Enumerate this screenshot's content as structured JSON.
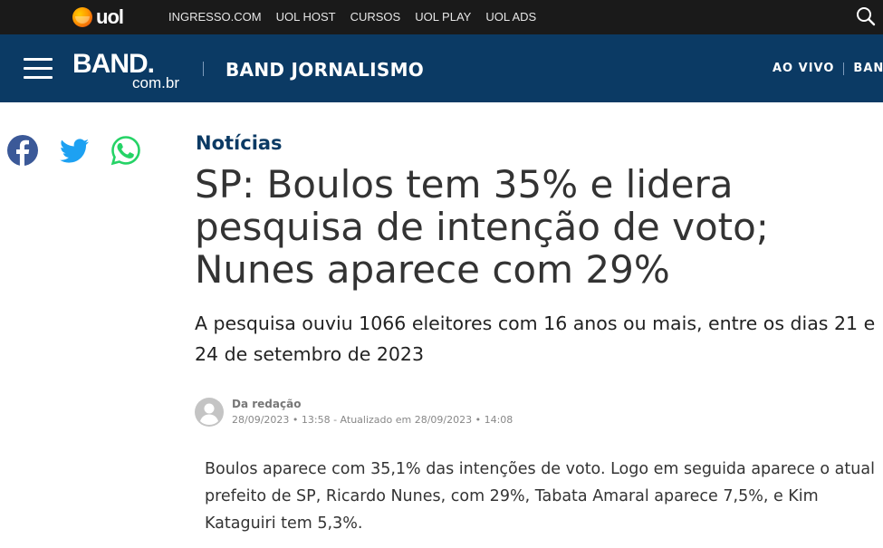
{
  "uol_bar": {
    "logo_text": "uol",
    "links": [
      "INGRESSO.COM",
      "UOL HOST",
      "CURSOS",
      "UOL PLAY",
      "UOL ADS"
    ],
    "search_icon": "search-icon"
  },
  "band_bar": {
    "logo_main": "BAND.",
    "logo_sub": "com.br",
    "section": "BAND JORNALISMO",
    "right_links": [
      "AO VIVO",
      "BAND"
    ],
    "menu_icon": "hamburger-menu-icon",
    "bg_color": "#0b3a64"
  },
  "share": {
    "icons": [
      "facebook-icon",
      "twitter-icon",
      "whatsapp-icon"
    ]
  },
  "article": {
    "kicker": "Notícias",
    "title_lines": [
      "SP: Boulos tem 35% e lidera",
      "pesquisa de intenção de voto;",
      "Nunes aparece com 29%"
    ],
    "subtitle": "A pesquisa ouviu 1066 eleitores com 16 anos ou mais, entre os dias 21 e 24 de setembro de 2023",
    "author": "Da redação",
    "dates": "28/09/2023 • 13:58 - Atualizado em 28/09/2023 • 14:08",
    "body": "Boulos aparece com 35,1% das intenções de voto. Logo em seguida aparece o atual prefeito de SP, Ricardo Nunes, com 29%, Tabata Amaral aparece 7,5%, e Kim Kataguiri tem 5,3%."
  }
}
